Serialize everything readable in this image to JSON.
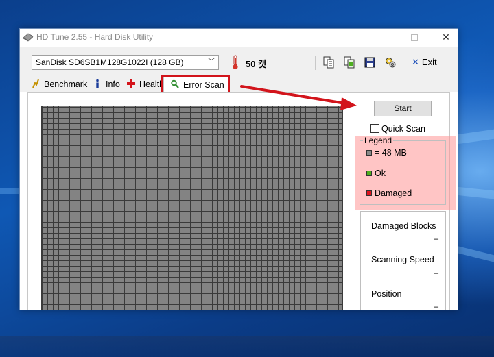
{
  "window": {
    "title": "HD Tune 2.55 - Hard Disk Utility",
    "close_glyph": "✕",
    "minimize_glyph": "—"
  },
  "toolbar": {
    "drive": "SanDisk SD6SB1M128G1022I (128 GB)",
    "temperature": "50 캣",
    "exit_label": "Exit",
    "icons": [
      "copy-info-icon",
      "copy-screen-icon",
      "save-icon",
      "options-icon"
    ]
  },
  "tabs": [
    {
      "label": "Benchmark",
      "icon": "benchmark-icon"
    },
    {
      "label": "Info",
      "icon": "info-icon"
    },
    {
      "label": "Health",
      "icon": "health-icon"
    },
    {
      "label": "Error Scan",
      "icon": "magnifier-icon",
      "active": true
    }
  ],
  "scan": {
    "start_label": "Start",
    "quick_scan_label": "Quick Scan",
    "quick_scan_checked": false
  },
  "legend": {
    "title": "Legend",
    "items": [
      {
        "label": "= 48 MB",
        "color": "#8a8a8a"
      },
      {
        "label": "Ok",
        "color": "#4caf1e"
      },
      {
        "label": "Damaged",
        "color": "#e0141e"
      }
    ]
  },
  "stats": {
    "damaged_blocks_label": "Damaged Blocks",
    "damaged_blocks_value": "–",
    "scanning_speed_label": "Scanning Speed",
    "scanning_speed_value": "–",
    "position_label": "Position",
    "position_value": "–"
  },
  "colors": {
    "highlight_red": "#d2141b",
    "legend_highlight": "#ff9696",
    "block_gray": "#838383"
  }
}
